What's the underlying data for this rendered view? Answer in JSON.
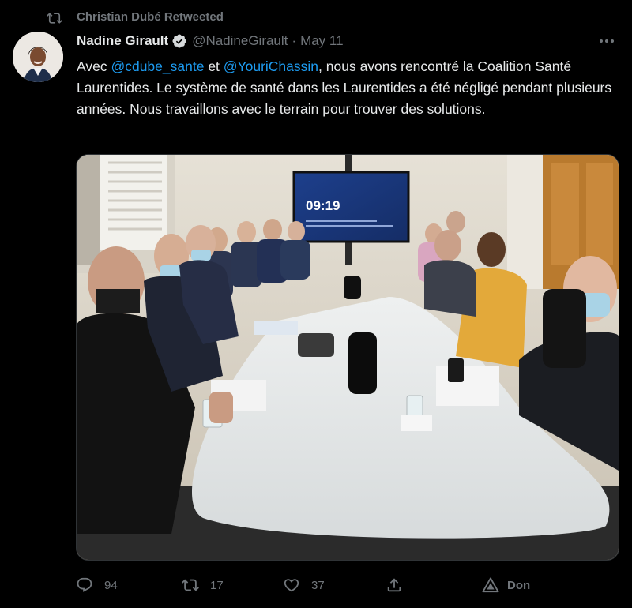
{
  "retweet": {
    "label": "Christian Dubé Retweeted"
  },
  "tweet": {
    "author_name": "Nadine Girault",
    "handle": "@NadineGirault",
    "separator": "·",
    "date": "May 11",
    "text_part1": "Avec ",
    "mention1": "@cdube_sante",
    "text_part2": " et ",
    "mention2": "@YouriChassin",
    "text_part3": ", nous avons rencontré la Coalition Santé Laurentides. Le système de santé dans les Laurentides a été négligé pendant plusieurs années. Nous travaillons avec le terrain pour trouver des solutions."
  },
  "media": {
    "screen_time": "09:19"
  },
  "actions": {
    "replies": "94",
    "retweets": "17",
    "likes": "37",
    "donate_label": "Don"
  },
  "icons": {
    "retweet": "retweet-icon",
    "verified": "verified-badge-icon",
    "more": "more-options-icon",
    "reply": "reply-icon",
    "like": "heart-icon",
    "share": "share-icon",
    "donate": "donate-icon"
  },
  "colors": {
    "background": "#000000",
    "text": "#e7e9ea",
    "muted": "#71767b",
    "mention": "#1d9bf0"
  }
}
